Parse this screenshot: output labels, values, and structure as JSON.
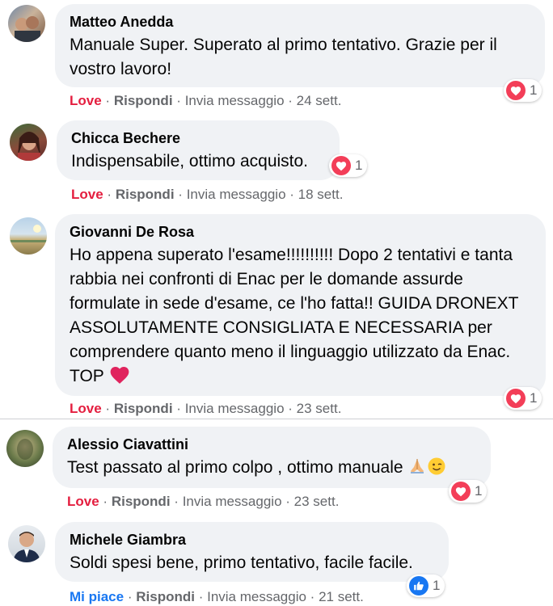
{
  "comments": [
    {
      "author": "Matteo Anedda",
      "text": "Manuale Super. Superato al primo tentativo. Grazie per il vostro lavoro!",
      "reaction_count": "1",
      "action_react": "Love",
      "action_reply": "Rispondi",
      "action_message": "Invia messaggio",
      "time": "24 sett."
    },
    {
      "author": "Chicca Bechere",
      "text": "Indispensabile, ottimo acquisto.",
      "reaction_count": "1",
      "action_react": "Love",
      "action_reply": "Rispondi",
      "action_message": "Invia messaggio",
      "time": "18 sett."
    },
    {
      "author": "Giovanni De Rosa",
      "text": "Ho appena superato l'esame!!!!!!!!!! Dopo 2 tentativi e tanta rabbia nei confronti di Enac per le domande assurde formulate in sede d'esame, ce l'ho fatta!! GUIDA DRONEXT ASSOLUTAMENTE CONSIGLIATA E NECESSARIA per comprendere quanto meno il linguaggio utilizzato da Enac. TOP",
      "reaction_count": "1",
      "action_react": "Love",
      "action_reply": "Rispondi",
      "action_message": "Invia messaggio",
      "time": "23 sett."
    },
    {
      "author": "Alessio Ciavattini",
      "text": "Test passato al primo colpo , ottimo manuale",
      "reaction_count": "1",
      "action_react": "Love",
      "action_reply": "Rispondi",
      "action_message": "Invia messaggio",
      "time": "23 sett."
    },
    {
      "author": "Michele Giambra",
      "text": "Soldi spesi bene, primo tentativo, facile facile.",
      "reaction_count": "1",
      "action_react": "Mi piace",
      "action_reply": "Rispondi",
      "action_message": "Invia messaggio",
      "time": "21 sett."
    }
  ],
  "separator": "·",
  "colors": {
    "bubble": "#f0f2f5",
    "love": "#e41e3f",
    "like": "#1877f2",
    "meta": "#65676b"
  },
  "icons": {
    "love": "heart-icon",
    "like": "thumbs-up-icon",
    "pray": "folded-hands-emoji",
    "wink": "winking-face-emoji"
  }
}
